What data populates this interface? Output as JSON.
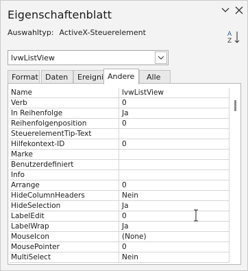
{
  "pane": {
    "title": "Eigenschaftenblatt",
    "selection_type_label": "Auswahltyp:",
    "selection_type_value": "ActiveX-Steuerelement",
    "object_combo": "lvwListView",
    "icons": {
      "collapse": "chevron-down-icon",
      "close": "close-icon",
      "sort": "sort-az-icon"
    }
  },
  "tabs": [
    {
      "label": "Format"
    },
    {
      "label": "Daten"
    },
    {
      "label": "Ereignis"
    },
    {
      "label": "Andere",
      "active": true
    },
    {
      "label": "Alle"
    }
  ],
  "properties": [
    {
      "name": "Name",
      "value": "lvwListView"
    },
    {
      "name": "Verb",
      "value": "0"
    },
    {
      "name": "In Reihenfolge",
      "value": "Ja"
    },
    {
      "name": "Reihenfolgenposition",
      "value": "0"
    },
    {
      "name": "SteuerelementTip-Text",
      "value": ""
    },
    {
      "name": "Hilfekontext-ID",
      "value": "0"
    },
    {
      "name": "Marke",
      "value": ""
    },
    {
      "name": "Benutzerdefiniert",
      "value": ""
    },
    {
      "name": "Info",
      "value": ""
    },
    {
      "name": "Arrange",
      "value": "0"
    },
    {
      "name": "HideColumnHeaders",
      "value": "Nein"
    },
    {
      "name": "HideSelection",
      "value": "Ja"
    },
    {
      "name": "LabelEdit",
      "value": "0"
    },
    {
      "name": "LabelWrap",
      "value": "Ja"
    },
    {
      "name": "MouseIcon",
      "value": "(None)"
    },
    {
      "name": "MousePointer",
      "value": "0"
    },
    {
      "name": "MultiSelect",
      "value": "Nein"
    }
  ]
}
